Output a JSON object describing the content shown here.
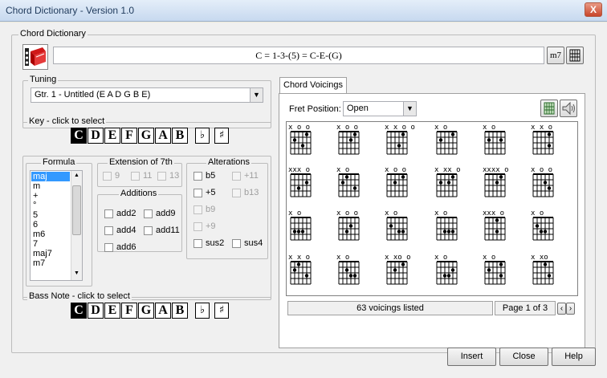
{
  "window": {
    "title": "Chord Dictionary - Version 1.0",
    "close": "X"
  },
  "dictionary": {
    "group_label": "Chord Dictionary",
    "formula_text": "C = 1-3-(5) = C-E-(G)",
    "m7_button": "m7"
  },
  "tuning": {
    "label": "Tuning",
    "value": "Gtr. 1 - Untitled (E A D G B E)"
  },
  "key": {
    "label": "Key - click to select",
    "notes": [
      "C",
      "D",
      "E",
      "F",
      "G",
      "A",
      "B"
    ],
    "selected": "C",
    "flat": "♭",
    "sharp": "♯"
  },
  "formula": {
    "label": "Formula",
    "items": [
      "maj",
      "m",
      "+",
      "°",
      "5",
      "6",
      "m6",
      "7",
      "maj7",
      "m7"
    ],
    "selected": "maj"
  },
  "extension": {
    "label": "Extension of 7th",
    "options": [
      "9",
      "11",
      "13"
    ]
  },
  "additions": {
    "label": "Additions",
    "options": [
      "add2",
      "add9",
      "add4",
      "add11",
      "add6"
    ]
  },
  "alterations": {
    "label": "Alterations",
    "options": [
      "b5",
      "+11",
      "+5",
      "b13",
      "b9",
      "+9",
      "sus2",
      "sus4"
    ]
  },
  "bass": {
    "label": "Bass Note - click to select",
    "notes": [
      "C",
      "D",
      "E",
      "F",
      "G",
      "A",
      "B"
    ],
    "selected": "C",
    "flat": "♭",
    "sharp": "♯"
  },
  "voicings": {
    "tab_label": "Chord Voicings",
    "fret_label": "Fret Position:",
    "fret_value": "Open",
    "count_text": "63 voicings listed",
    "page_text": "Page 1 of 3",
    "prev": "‹",
    "next": "›",
    "markers": [
      "x    o  o",
      "x  o  o",
      "x x  o  o",
      "x    o",
      "x    o",
      "x x  o",
      "xxx    o",
      "x    o",
      "x  o  o",
      "x  xx  o",
      "xxxx  o",
      "x    o  o",
      "x    o",
      "x  o  o",
      "x    o",
      "x    o",
      "xxx  o",
      "x    o",
      "x  x  o",
      "x    o",
      "x  xo  o",
      "x    o",
      "x    o",
      "x  xo"
    ]
  },
  "buttons": {
    "insert": "Insert",
    "close": "Close",
    "help": "Help"
  }
}
